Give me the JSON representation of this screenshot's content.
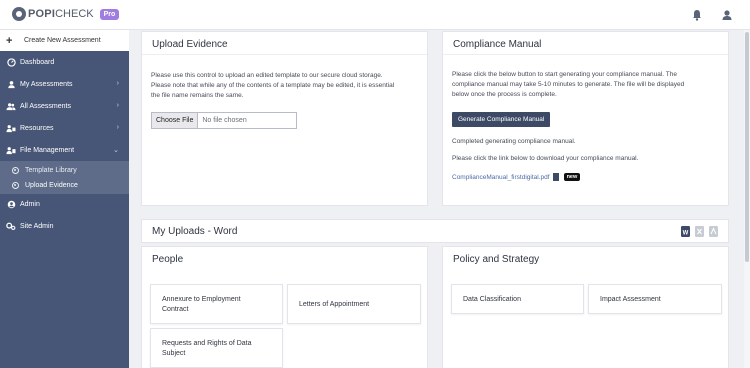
{
  "brand": {
    "name_bold": "POPI",
    "name_rest": "CHECK",
    "badge": "Pro"
  },
  "topbar": {
    "icons": [
      "bell-icon",
      "user-icon"
    ]
  },
  "sidebar": {
    "create_label": "Create New Assessment",
    "items": [
      {
        "label": "Dashboard",
        "icon": "dashboard-icon",
        "chevron": ""
      },
      {
        "label": "My Assessments",
        "icon": "user-icon",
        "chevron": "›"
      },
      {
        "label": "All Assessments",
        "icon": "users-icon",
        "chevron": "›"
      },
      {
        "label": "Resources",
        "icon": "resources-icon",
        "chevron": "›"
      },
      {
        "label": "File Management",
        "icon": "file-management-icon",
        "chevron": "⌄"
      },
      {
        "label": "Admin",
        "icon": "admin-icon",
        "chevron": ""
      },
      {
        "label": "Site Admin",
        "icon": "site-admin-icon",
        "chevron": ""
      }
    ],
    "subitems": [
      {
        "label": "Template Library"
      },
      {
        "label": "Upload Evidence"
      }
    ]
  },
  "upload": {
    "title": "Upload Evidence",
    "line1": "Please use this control to upload an edited template to our secure cloud storage.",
    "line2": "Please note that while any of the contents of a template may be edited, it is essential",
    "line3": "the file name remains the same.",
    "choose_label": "Choose File",
    "no_file_label": "No file chosen"
  },
  "manual": {
    "title": "Compliance Manual",
    "line1": "Please click the below button to start generating your compliance manual. The",
    "line2": "compliance manual may take 5-10 minutes to generate. The file will be displayed",
    "line3": "below once the process is complete.",
    "button_label": "Generate Compliance Manual",
    "completed": "Completed generating compliance manual.",
    "download_hint": "Please click the link below to download your compliance manual.",
    "file_link": "ComplianceManual_firstdigital.pdf",
    "new_badge": "new"
  },
  "uploads": {
    "title": "My Uploads - Word",
    "formats": [
      "word-icon",
      "excel-icon",
      "pdf-icon"
    ]
  },
  "people": {
    "title": "People",
    "tiles": [
      [
        "Annexure to Employment",
        "Contract"
      ],
      [
        "Letters of Appointment"
      ],
      [
        "Requests and Rights of Data",
        "Subject"
      ]
    ]
  },
  "policy": {
    "title": "Policy and Strategy",
    "tiles": [
      [
        "Data Classification"
      ],
      [
        "Impact Assessment"
      ]
    ]
  },
  "colors": {
    "sidebar": "#475677",
    "submenu": "#5e6c8a",
    "button": "#3d4a66",
    "link": "#4a6ca8",
    "badge": "#a07ee0"
  }
}
